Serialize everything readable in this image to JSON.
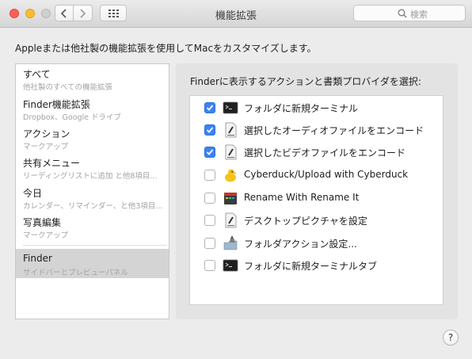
{
  "window": {
    "title": "機能拡張"
  },
  "search": {
    "placeholder": "検索"
  },
  "description": "Appleまたは他社製の機能拡張を使用してMacをカスタマイズします。",
  "sidebar": {
    "items": [
      {
        "label": "すべて",
        "sublabel": "他社製のすべての機能拡張",
        "selected": false
      },
      {
        "label": "Finder機能拡張",
        "sublabel": "Dropbox、Google ドライブ",
        "selected": false
      },
      {
        "label": "アクション",
        "sublabel": "マークアップ",
        "selected": false
      },
      {
        "label": "共有メニュー",
        "sublabel": "リーディングリストに追加 と他8項目...",
        "selected": false
      },
      {
        "label": "今日",
        "sublabel": "カレンダー、リマインダー、と他3項目...",
        "selected": false
      },
      {
        "label": "写真編集",
        "sublabel": "マークアップ",
        "selected": false
      },
      {
        "label": "Finder",
        "sublabel": "サイドバーとプレビューパネル",
        "selected": true
      }
    ]
  },
  "panel": {
    "title": "Finderに表示するアクションと書類プロバイダを選択:",
    "items": [
      {
        "label": "フォルダに新規ターミナル",
        "checked": true,
        "icon": "terminal-icon"
      },
      {
        "label": "選択したオーディオファイルをエンコード",
        "checked": true,
        "icon": "script-icon"
      },
      {
        "label": "選択したビデオファイルをエンコード",
        "checked": true,
        "icon": "script-icon"
      },
      {
        "label": "Cyberduck/Upload with Cyberduck",
        "checked": false,
        "icon": "cyberduck-icon"
      },
      {
        "label": "Rename With Rename It",
        "checked": false,
        "icon": "rename-it-icon"
      },
      {
        "label": "デスクトップピクチャを設定",
        "checked": false,
        "icon": "script-icon"
      },
      {
        "label": "フォルダアクション設定...",
        "checked": false,
        "icon": "folder-actions-icon"
      },
      {
        "label": "フォルダに新規ターミナルタブ",
        "checked": false,
        "icon": "terminal-icon"
      }
    ]
  },
  "help": {
    "label": "?"
  },
  "colors": {
    "accent": "#3b82f6",
    "selection": "#d4d4d4"
  }
}
